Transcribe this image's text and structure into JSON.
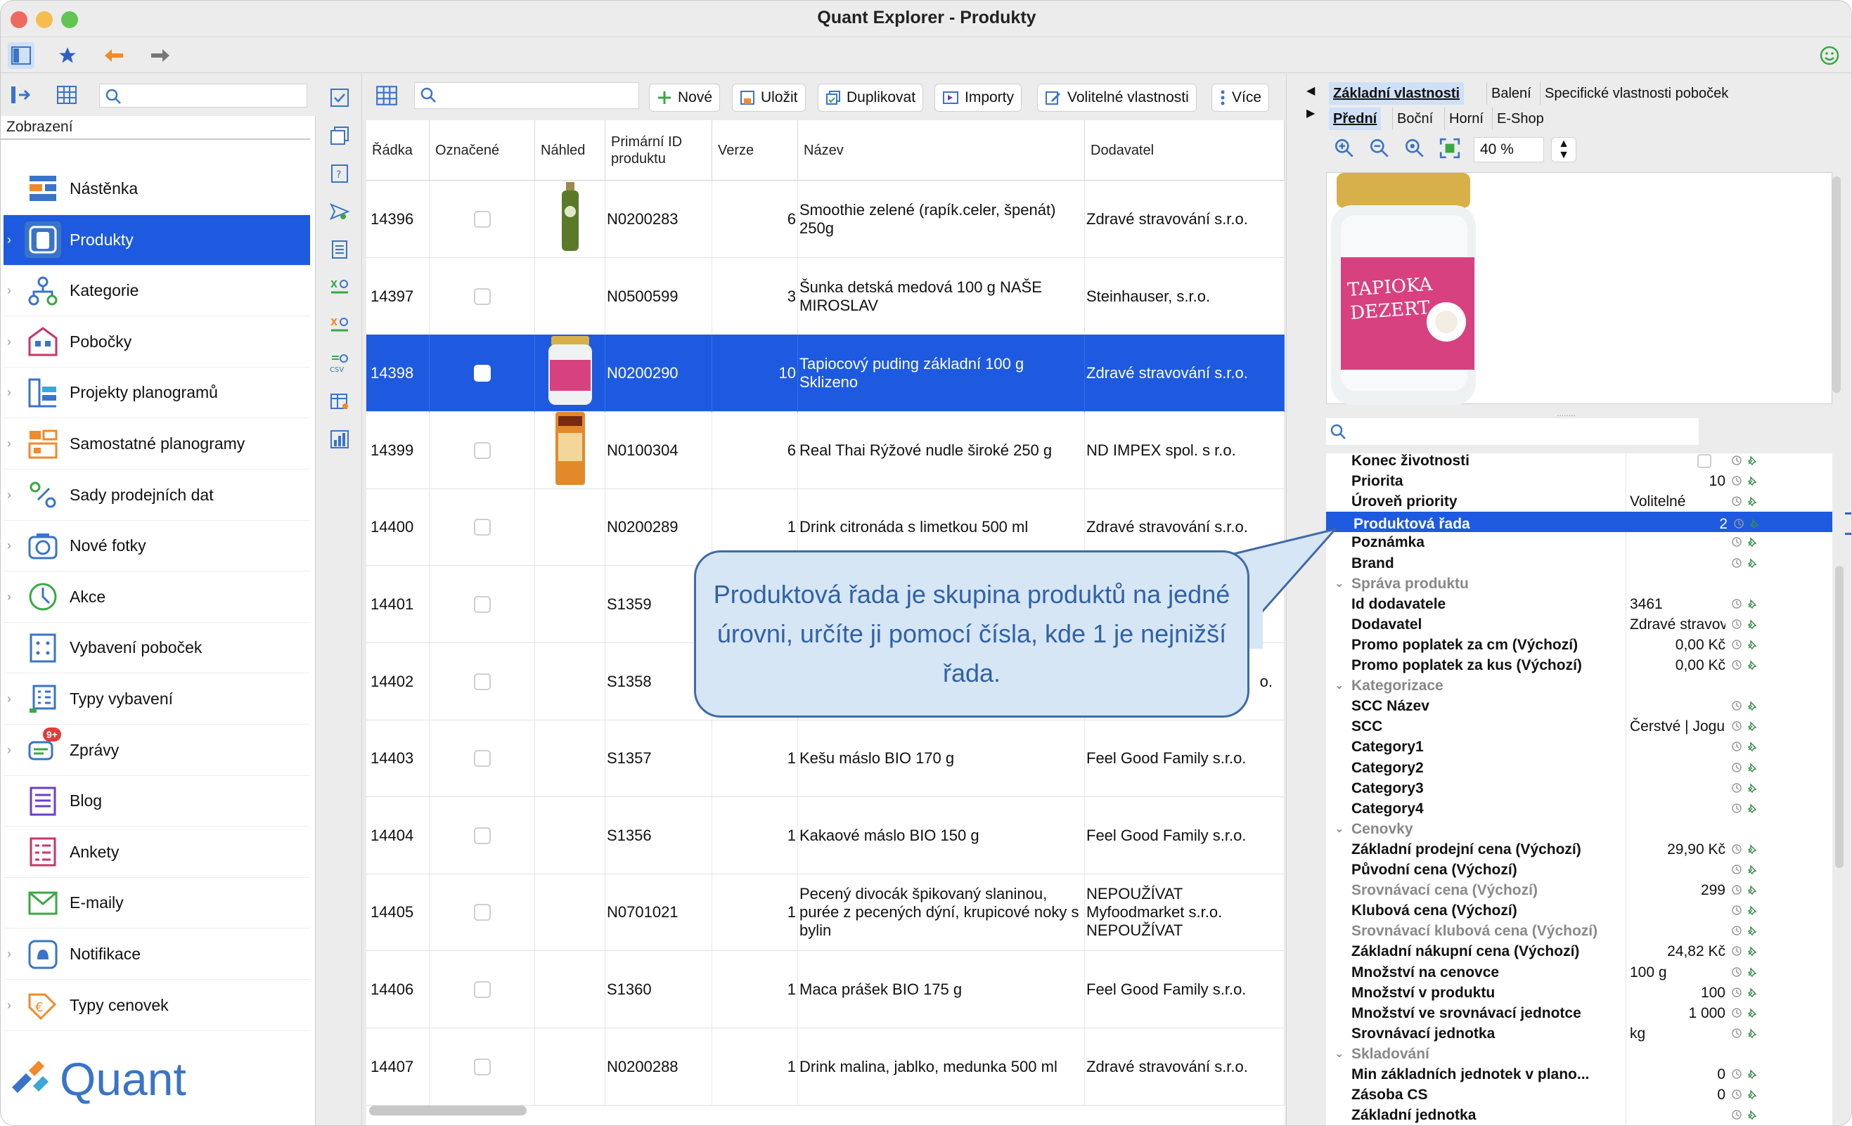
{
  "window": {
    "title": "Quant Explorer - Produkty"
  },
  "colors": {
    "accent": "#1d5ae0",
    "callout_bg": "#d7e6f5",
    "callout_text": "#2f62a8",
    "brand": "#3a74c7"
  },
  "left_panel": {
    "section_label": "Zobrazení",
    "items": [
      {
        "label": "Nástěnka",
        "icon": "dashboard-icon",
        "chevron": false
      },
      {
        "label": "Produkty",
        "icon": "product-box-icon",
        "chevron": true,
        "selected": true
      },
      {
        "label": "Kategorie",
        "icon": "category-tree-icon",
        "chevron": true
      },
      {
        "label": "Pobočky",
        "icon": "store-icon",
        "chevron": true
      },
      {
        "label": "Projekty planogramů",
        "icon": "planogram-project-icon",
        "chevron": true
      },
      {
        "label": "Samostatné planogramy",
        "icon": "planogram-icon",
        "chevron": true
      },
      {
        "label": "Sady prodejních dat",
        "icon": "sales-data-icon",
        "chevron": true
      },
      {
        "label": "Nové fotky",
        "icon": "camera-icon",
        "chevron": true
      },
      {
        "label": "Akce",
        "icon": "clock-icon",
        "chevron": true
      },
      {
        "label": "Vybavení poboček",
        "icon": "equipment-icon",
        "chevron": false
      },
      {
        "label": "Typy vybavení",
        "icon": "equipment-types-icon",
        "chevron": true
      },
      {
        "label": "Zprávy",
        "icon": "messages-icon",
        "chevron": true,
        "badge": "9+"
      },
      {
        "label": "Blog",
        "icon": "blog-icon",
        "chevron": false
      },
      {
        "label": "Ankety",
        "icon": "survey-icon",
        "chevron": false
      },
      {
        "label": "E-maily",
        "icon": "email-icon",
        "chevron": false
      },
      {
        "label": "Notifikace",
        "icon": "bell-icon",
        "chevron": true
      },
      {
        "label": "Typy cenovek",
        "icon": "price-tag-icon",
        "chevron": true
      }
    ],
    "logo": "Quant"
  },
  "table_toolbar": {
    "new": "Nové",
    "save": "Uložit",
    "duplicate": "Duplikovat",
    "imports": "Importy",
    "optional_props": "Volitelné vlastnosti",
    "more": "Více"
  },
  "table": {
    "columns": [
      "Řádka",
      "Označené",
      "Náhled",
      "Primární ID produktu",
      "Verze",
      "Název",
      "Dodavatel"
    ],
    "rows": [
      {
        "radka": "14396",
        "id": "N0200283",
        "verze": "6",
        "nazev": "Smoothie zelené (rapík.celer, špenát) 250g",
        "dodavatel": "Zdravé stravování s.r.o.",
        "thumb": "green-bottle"
      },
      {
        "radka": "14397",
        "id": "N0500599",
        "verze": "3",
        "nazev": "Šunka detská medová 100 g NAŠE MIROSLAV",
        "dodavatel": "Steinhauser, s.r.o.",
        "thumb": ""
      },
      {
        "radka": "14398",
        "id": "N0200290",
        "verze": "10",
        "nazev": "Tapiocový puding základní 100 g Sklizeno",
        "dodavatel": "Zdravé stravování s.r.o.",
        "thumb": "jar",
        "selected": true
      },
      {
        "radka": "14399",
        "id": "N0100304",
        "verze": "6",
        "nazev": "Real Thai Rýžové nudle široké 250 g",
        "dodavatel": "ND IMPEX  spol. s r.o.",
        "thumb": "noodles"
      },
      {
        "radka": "14400",
        "id": "N0200289",
        "verze": "1",
        "nazev": "Drink citronáda s limetkou 500 ml",
        "dodavatel": "Zdravé stravování s.r.o.",
        "thumb": ""
      },
      {
        "radka": "14401",
        "id": "S1359",
        "verze": "",
        "nazev": "",
        "dodavatel": "",
        "thumb": ""
      },
      {
        "radka": "14402",
        "id": "S1358",
        "verze": "",
        "nazev": "",
        "dodavatel": "o.",
        "thumb": ""
      },
      {
        "radka": "14403",
        "id": "S1357",
        "verze": "1",
        "nazev": "Kešu máslo BIO 170 g",
        "dodavatel": "Feel Good Family s.r.o.",
        "thumb": ""
      },
      {
        "radka": "14404",
        "id": "S1356",
        "verze": "1",
        "nazev": "Kakaové máslo BIO 150 g",
        "dodavatel": "Feel Good Family s.r.o.",
        "thumb": ""
      },
      {
        "radka": "14405",
        "id": "N0701021",
        "verze": "1",
        "nazev": "Pecený divocák špikovaný slaninou, purée z pecených dýní, krupicové noky s bylin",
        "dodavatel": "NEPOUŽÍVAT Myfoodmarket s.r.o. NEPOUŽÍVAT",
        "thumb": ""
      },
      {
        "radka": "14406",
        "id": "S1360",
        "verze": "1",
        "nazev": "Maca prášek BIO 175 g",
        "dodavatel": "Feel Good Family s.r.o.",
        "thumb": ""
      },
      {
        "radka": "14407",
        "id": "N0200288",
        "verze": "1",
        "nazev": "Drink malina, jablko, medunka 500 ml",
        "dodavatel": "Zdravé stravování s.r.o.",
        "thumb": ""
      }
    ]
  },
  "right_panel": {
    "tabs_top": [
      "Základní vlastnosti",
      "Balení",
      "Specifické vlastnosti poboček"
    ],
    "tabs_view": [
      "Přední",
      "Boční",
      "Horní",
      "E-Shop"
    ],
    "zoom": "40 %",
    "image_label": "TAPIOKA DEZERT",
    "properties": [
      {
        "name": "Konec životnosti",
        "value": "",
        "type": "checkbox"
      },
      {
        "name": "Priorita",
        "value": "10",
        "align": "right"
      },
      {
        "name": "Úroveň priority",
        "value": "Volitelné"
      },
      {
        "name": "Produktová řada",
        "value": "2",
        "align": "right",
        "selected": true
      },
      {
        "name": "Poznámka",
        "value": ""
      },
      {
        "name": "Brand",
        "value": ""
      },
      {
        "name": "Správa produktu",
        "category": true
      },
      {
        "name": "Id dodavatele",
        "value": "3461"
      },
      {
        "name": "Dodavatel",
        "value": "Zdravé stravová..."
      },
      {
        "name": "Promo poplatek za cm (Výchozí)",
        "value": "0,00 Kč",
        "align": "right"
      },
      {
        "name": "Promo poplatek za kus (Výchozí)",
        "value": "0,00 Kč",
        "align": "right"
      },
      {
        "name": "Kategorizace",
        "category": true
      },
      {
        "name": "SCC Název",
        "value": ""
      },
      {
        "name": "SCC",
        "value": "Čerstvé | Jogurty..."
      },
      {
        "name": "Category1",
        "value": ""
      },
      {
        "name": "Category2",
        "value": ""
      },
      {
        "name": "Category3",
        "value": ""
      },
      {
        "name": "Category4",
        "value": ""
      },
      {
        "name": "Cenovky",
        "category": true
      },
      {
        "name": "Základní prodejní cena (Výchozí)",
        "value": "29,90 Kč",
        "align": "right"
      },
      {
        "name": "Původní cena (Výchozí)",
        "value": ""
      },
      {
        "name": "Srovnávací cena (Výchozí)",
        "value": "299",
        "align": "right",
        "grey": true
      },
      {
        "name": "Klubová cena (Výchozí)",
        "value": ""
      },
      {
        "name": "Srovnávací klubová cena (Výchozí)",
        "value": "",
        "grey": true
      },
      {
        "name": "Základní nákupní cena (Výchozí)",
        "value": "24,82 Kč",
        "align": "right"
      },
      {
        "name": "Množství na cenovce",
        "value": "100 g"
      },
      {
        "name": "Množství v produktu",
        "value": "100",
        "align": "right"
      },
      {
        "name": "Množství ve srovnávací jednotce",
        "value": "1 000",
        "align": "right"
      },
      {
        "name": "Srovnávací jednotka",
        "value": "kg"
      },
      {
        "name": "Skladování",
        "category": true
      },
      {
        "name": "Min základních jednotek v plano...",
        "value": "0",
        "align": "right"
      },
      {
        "name": "Zásoba CS",
        "value": "0",
        "align": "right"
      },
      {
        "name": "Základní jednotka",
        "value": ""
      }
    ]
  },
  "callout": {
    "text": "Produktová řada je skupina produktů na jedné úrovni, určíte ji pomocí čísla, kde 1 je nejnižší řada."
  }
}
